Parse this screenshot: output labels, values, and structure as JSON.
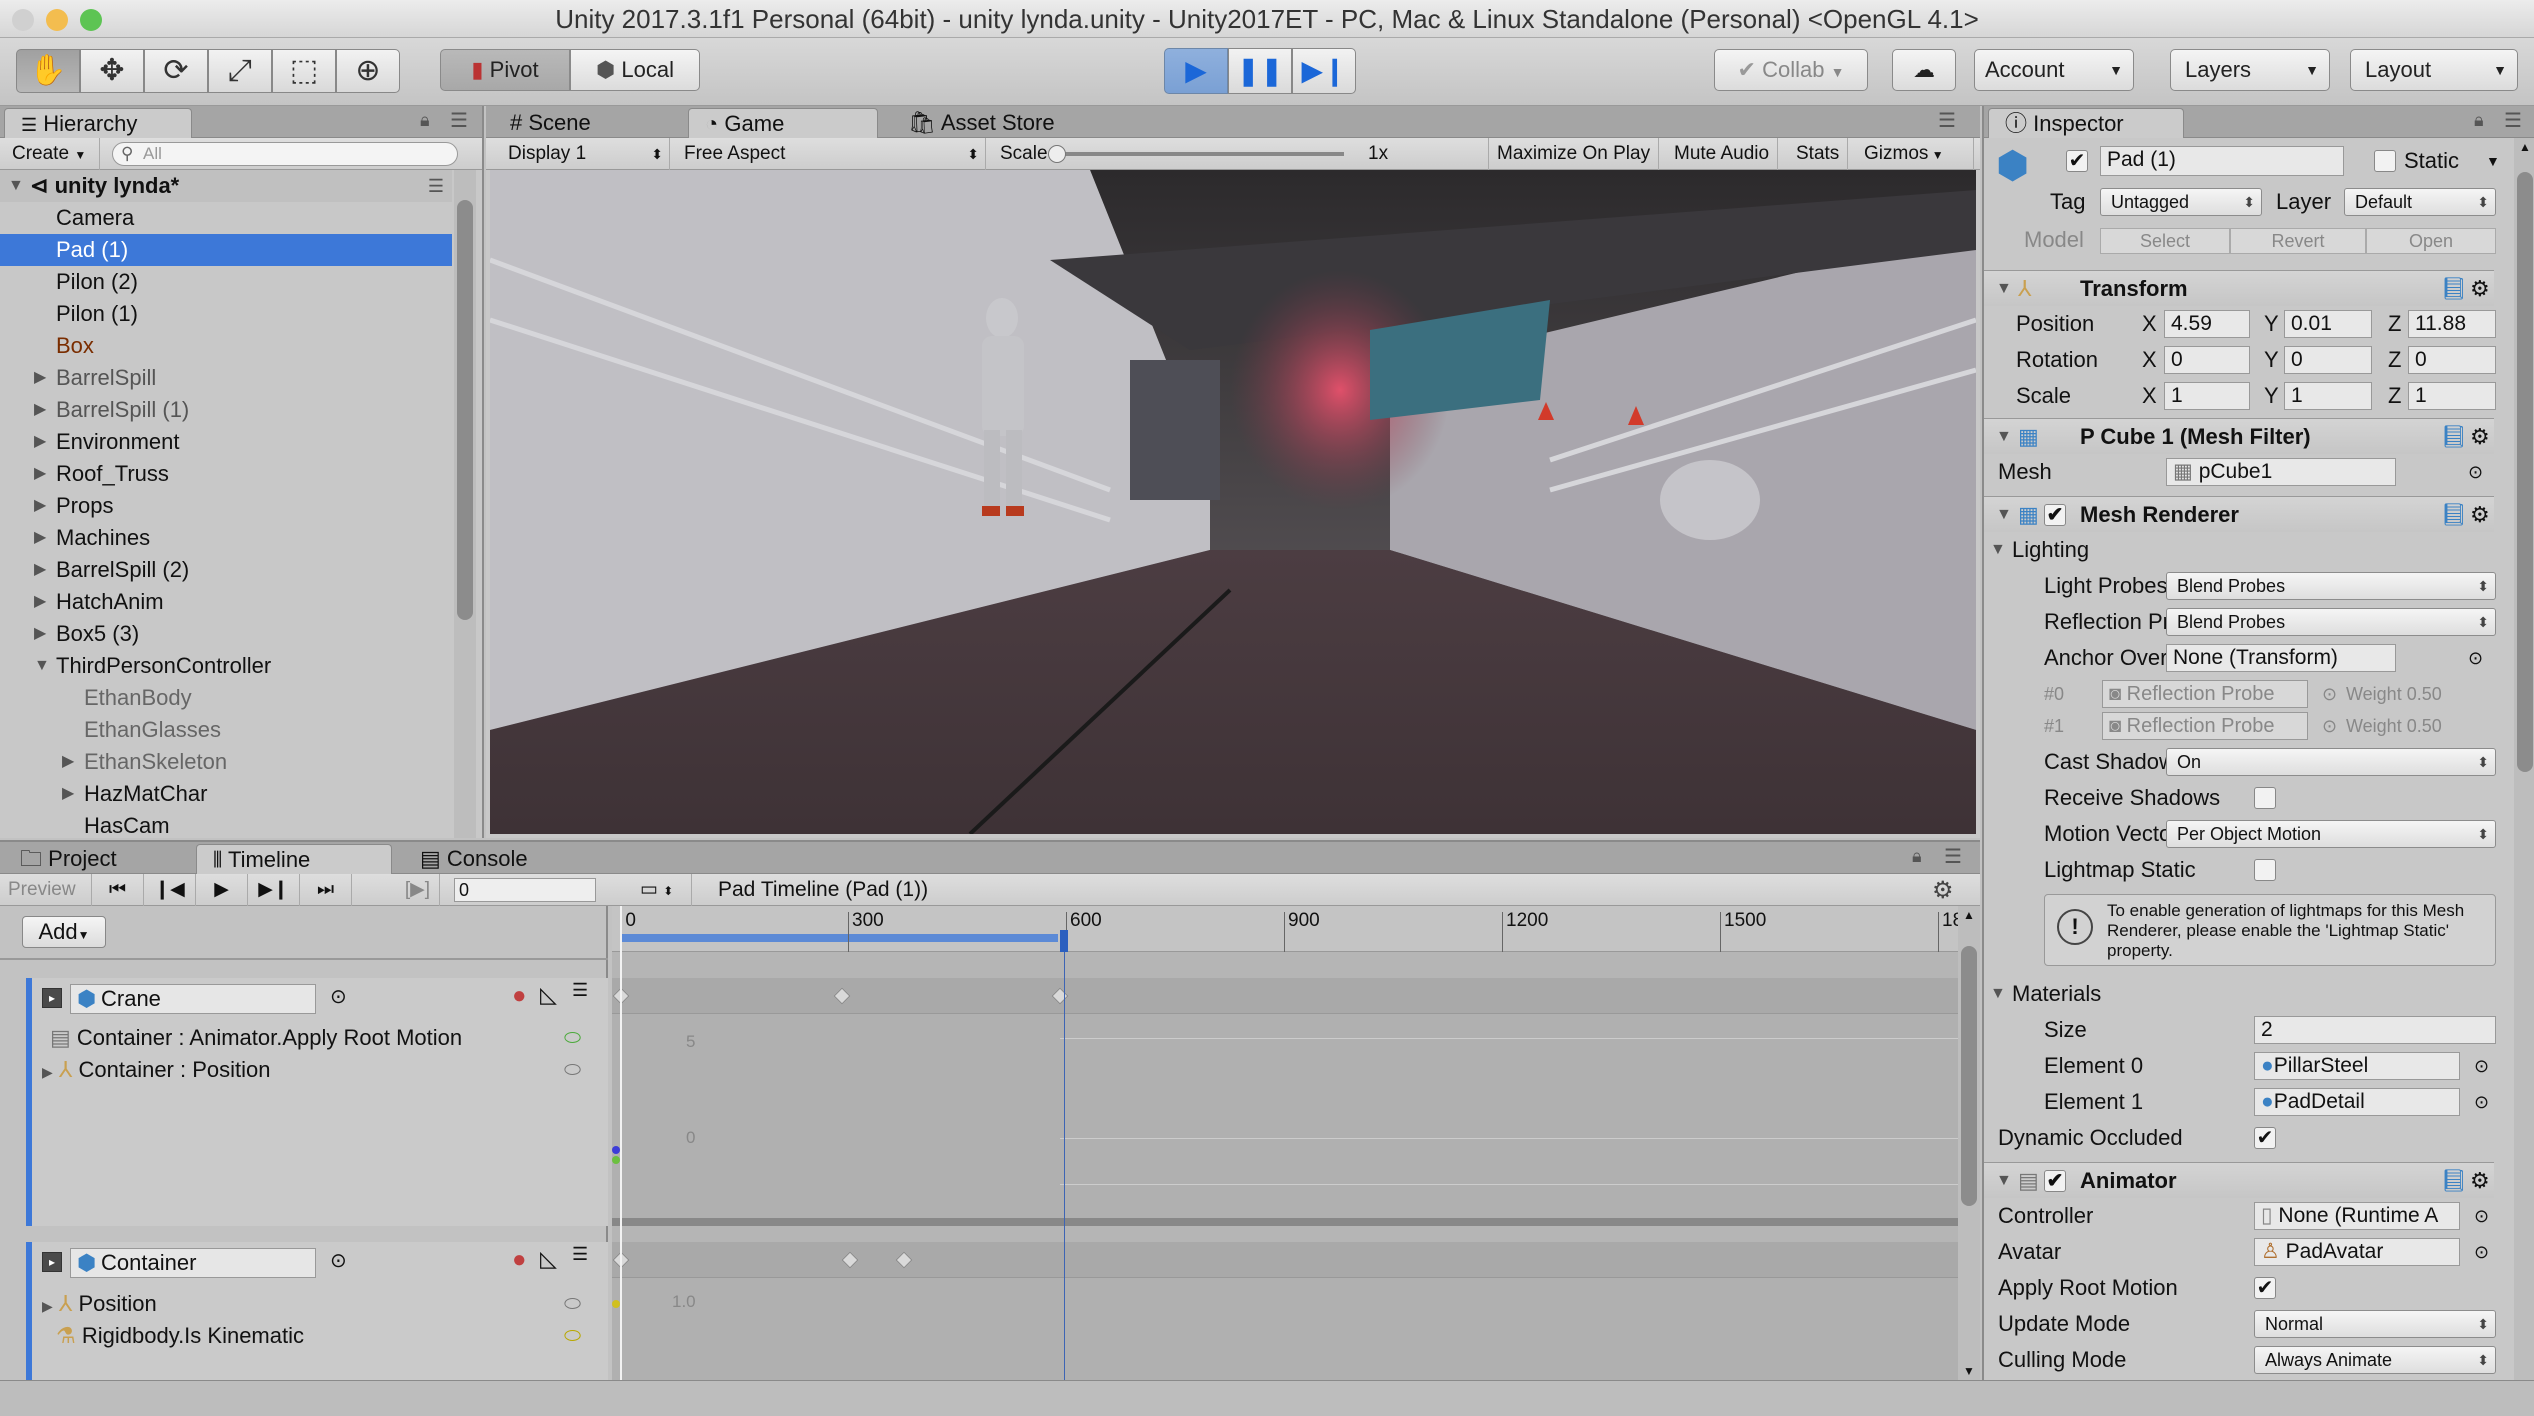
{
  "window": {
    "title": "Unity 2017.3.1f1 Personal (64bit) - unity lynda.unity - Unity2017ET - PC, Mac & Linux Standalone (Personal) <OpenGL 4.1>"
  },
  "toolbar": {
    "pivot": "Pivot",
    "local": "Local",
    "collab": "Collab",
    "account": "Account",
    "layers": "Layers",
    "layout": "Layout"
  },
  "hierarchy": {
    "tab": "Hierarchy",
    "create": "Create",
    "search_placeholder": "All",
    "scene": "unity lynda*",
    "items": [
      {
        "label": "Camera"
      },
      {
        "label": "Pad (1)"
      },
      {
        "label": "Pilon (2)"
      },
      {
        "label": "Pilon (1)"
      },
      {
        "label": "Box"
      },
      {
        "label": "BarrelSpill"
      },
      {
        "label": "BarrelSpill (1)"
      },
      {
        "label": "Environment"
      },
      {
        "label": "Roof_Truss"
      },
      {
        "label": "Props"
      },
      {
        "label": "Machines"
      },
      {
        "label": "BarrelSpill (2)"
      },
      {
        "label": "HatchAnim"
      },
      {
        "label": "Box5 (3)"
      },
      {
        "label": "ThirdPersonController"
      },
      {
        "label": "EthanBody"
      },
      {
        "label": "EthanGlasses"
      },
      {
        "label": "EthanSkeleton"
      },
      {
        "label": "HazMatChar"
      },
      {
        "label": "HasCam"
      }
    ]
  },
  "center": {
    "tabs": [
      "Scene",
      "Game",
      "Asset Store"
    ],
    "display": "Display 1",
    "aspect": "Free Aspect",
    "scale_label": "Scale",
    "scale_value": "1x",
    "maximize": "Maximize On Play",
    "mute": "Mute Audio",
    "stats": "Stats",
    "gizmos": "Gizmos"
  },
  "timeline": {
    "tabs": [
      "Project",
      "Timeline",
      "Console"
    ],
    "preview": "Preview",
    "frame": "0",
    "asset": "Pad Timeline (Pad (1))",
    "add": "Add",
    "ruler": [
      "0",
      "300",
      "600",
      "900",
      "1200",
      "1500",
      "18"
    ],
    "curve_labels": [
      "5",
      "0",
      "1.0"
    ],
    "track1": {
      "name": "Crane",
      "rows": [
        "Container : Animator.Apply Root Motion",
        "Container : Position"
      ]
    },
    "track2": {
      "name": "Container",
      "rows": [
        "Position",
        "Rigidbody.Is Kinematic"
      ]
    }
  },
  "inspector": {
    "tab": "Inspector",
    "name": "Pad (1)",
    "static": "Static",
    "tag_label": "Tag",
    "tag": "Untagged",
    "layer_label": "Layer",
    "layer": "Default",
    "model_label": "Model",
    "model_btns": [
      "Select",
      "Revert",
      "Open"
    ],
    "transform": {
      "title": "Transform",
      "position_label": "Position",
      "position": [
        "4.59",
        "0.01",
        "11.88"
      ],
      "rotation_label": "Rotation",
      "rotation": [
        "0",
        "0",
        "0"
      ],
      "scale_label": "Scale",
      "scale": [
        "1",
        "1",
        "1"
      ],
      "axes": [
        "X",
        "Y",
        "Z"
      ]
    },
    "meshfilter": {
      "title": "P Cube 1 (Mesh Filter)",
      "mesh_label": "Mesh",
      "mesh": "pCube1"
    },
    "renderer": {
      "title": "Mesh Renderer",
      "lighting": "Lighting",
      "light_probes_label": "Light Probes",
      "light_probes": "Blend Probes",
      "reflection_probes_label": "Reflection Probes",
      "reflection_probes": "Blend Probes",
      "anchor_label": "Anchor Override",
      "anchor": "None (Transform)",
      "probe0_idx": "#0",
      "probe1_idx": "#1",
      "probe_name": "Reflection Probe",
      "weight": "Weight 0.50",
      "cast_label": "Cast Shadows",
      "cast": "On",
      "receive_label": "Receive Shadows",
      "motion_label": "Motion Vectors",
      "motion": "Per Object Motion",
      "lightmap_label": "Lightmap Static",
      "info": "To enable generation of lightmaps for this Mesh Renderer, please enable the 'Lightmap Static' property.",
      "materials": "Materials",
      "size_label": "Size",
      "size": "2",
      "el0_label": "Element 0",
      "el0": "PillarSteel",
      "el1_label": "Element 1",
      "el1": "PadDetail",
      "dyn_label": "Dynamic Occluded"
    },
    "animator": {
      "title": "Animator",
      "controller_label": "Controller",
      "controller": "None (Runtime A",
      "avatar_label": "Avatar",
      "avatar": "PadAvatar",
      "root_label": "Apply Root Motion",
      "update_label": "Update Mode",
      "update": "Normal",
      "culling_label": "Culling Mode",
      "culling": "Always Animate"
    }
  },
  "colors": {
    "selection": "#3d78d8",
    "play": "#1b67d8",
    "record": "#c04040"
  }
}
